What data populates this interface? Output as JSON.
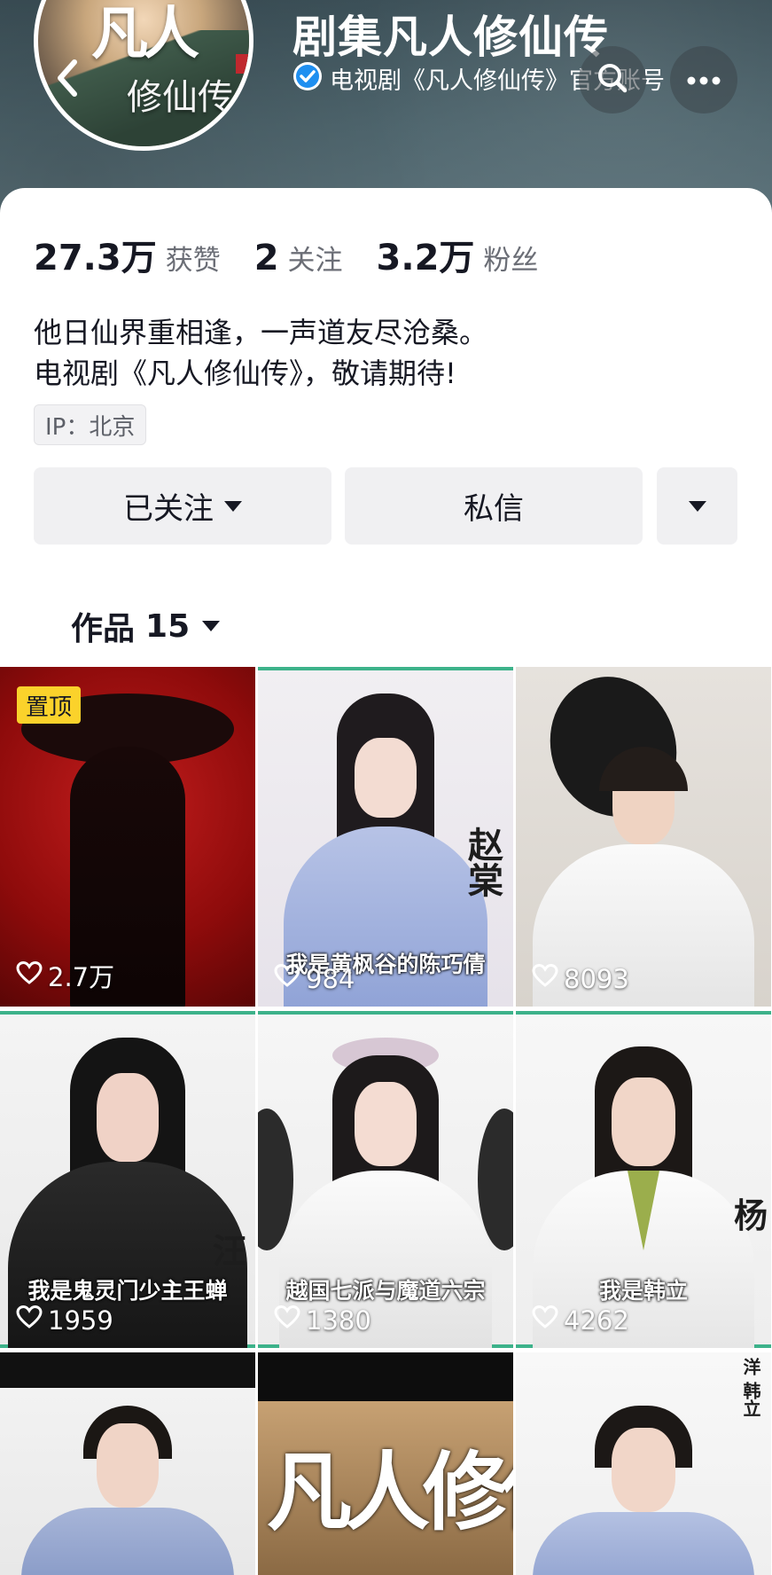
{
  "header": {
    "avatar": {
      "title": "凡人",
      "subtitle": "修仙传"
    },
    "name": "剧集凡人修仙传",
    "verified_text": "电视剧《凡人修仙传》官方账号",
    "icons": {
      "back": "chevron-left-icon",
      "search": "search-icon",
      "more": "more-dots-icon",
      "verified": "verified-check-icon"
    }
  },
  "stats": [
    {
      "value": "27.3万",
      "label": "获赞"
    },
    {
      "value": "2",
      "label": "关注"
    },
    {
      "value": "3.2万",
      "label": "粉丝"
    }
  ],
  "bio": {
    "line1": "他日仙界重相逢，一声道友尽沧桑。",
    "line2": "电视剧《凡人修仙传》，敬请期待!"
  },
  "ip_location": "IP：北京",
  "actions": {
    "followed": "已关注",
    "message": "私信"
  },
  "works": {
    "label": "作品",
    "count": "15"
  },
  "videos": [
    {
      "pinned": "置顶",
      "likes": "2.7万",
      "caption": "",
      "side": ""
    },
    {
      "pinned": "",
      "likes": "984",
      "caption": "我是黄枫谷的陈巧倩",
      "side": "赵棠"
    },
    {
      "pinned": "",
      "likes": "8093",
      "caption": "",
      "side": ""
    },
    {
      "pinned": "",
      "likes": "1959",
      "caption": "我是鬼灵门少主王蝉",
      "side": "汪"
    },
    {
      "pinned": "",
      "likes": "1380",
      "caption": "越国七派与魔道六宗",
      "side": ""
    },
    {
      "pinned": "",
      "likes": "4262",
      "caption": "我是韩立",
      "side": "杨"
    },
    {
      "pinned": "",
      "likes": "",
      "caption": "",
      "side": ""
    },
    {
      "pinned": "",
      "likes": "",
      "caption": "",
      "side": "凡人修仙"
    },
    {
      "pinned": "",
      "likes": "",
      "caption": "",
      "side": "洋 韩立"
    }
  ],
  "colors": {
    "pin_badge": "#fbd22b",
    "button_bg": "#f0f0f2",
    "verified": "#1f8ff0",
    "text": "#161823"
  }
}
